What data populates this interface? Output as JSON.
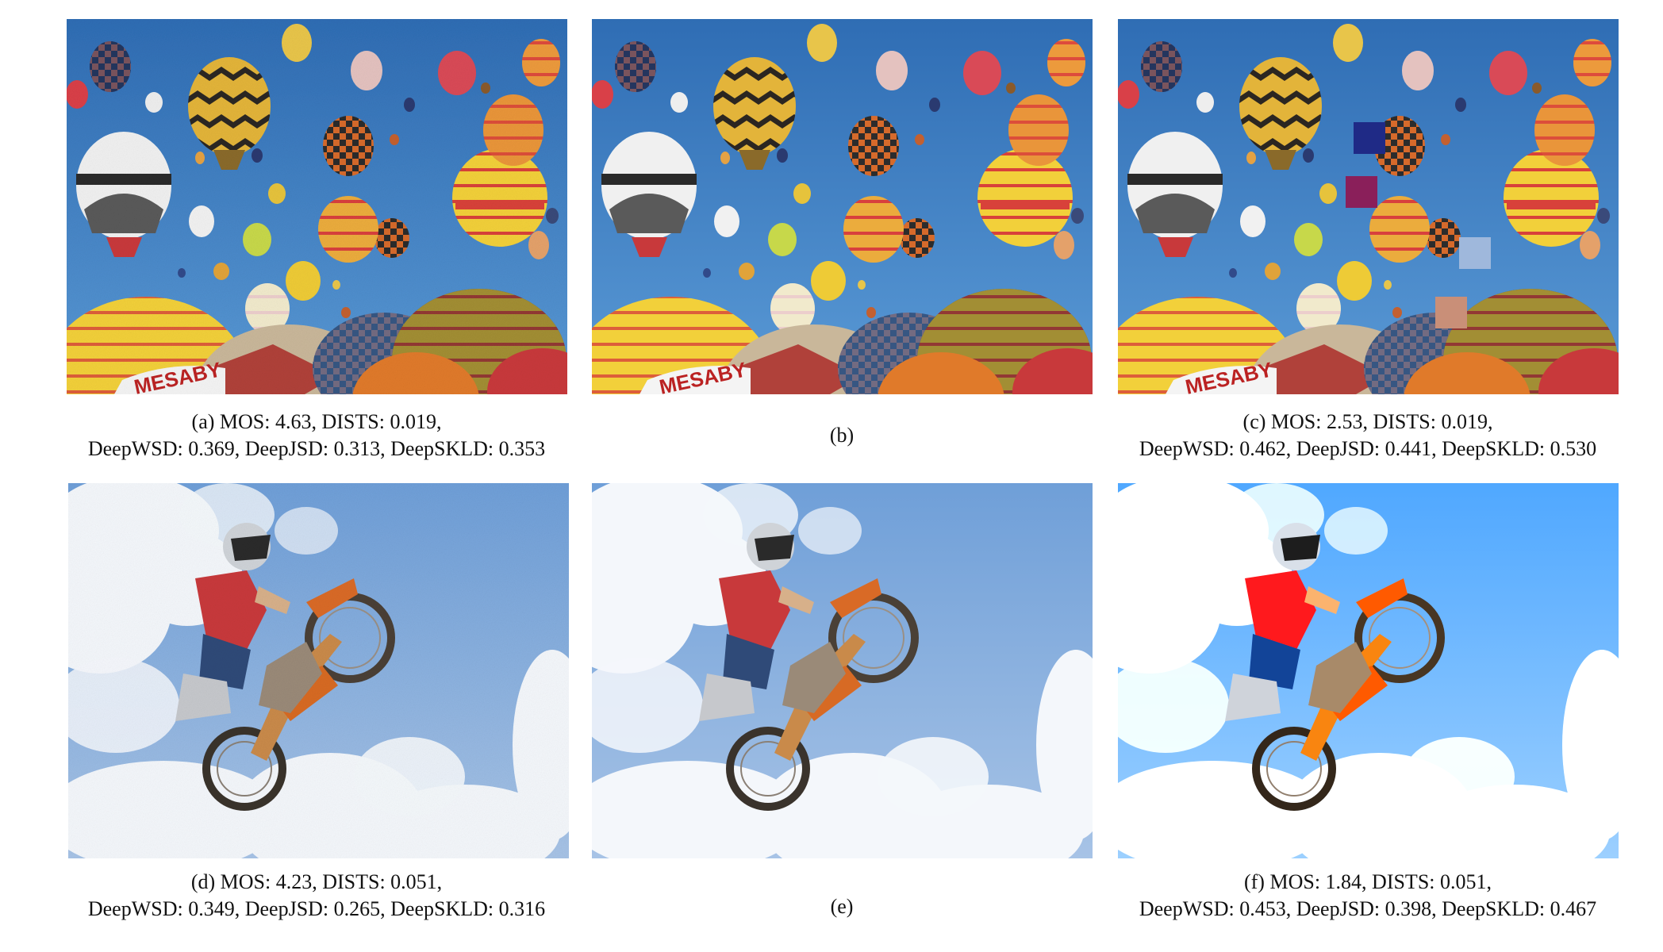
{
  "figure": {
    "panels": [
      {
        "id": "a",
        "scene": "hot-air-balloons",
        "variant": "distorted-noise"
      },
      {
        "id": "b",
        "scene": "hot-air-balloons",
        "variant": "reference"
      },
      {
        "id": "c",
        "scene": "hot-air-balloons",
        "variant": "color-patches"
      },
      {
        "id": "d",
        "scene": "motocross-jump",
        "variant": "distorted-noise"
      },
      {
        "id": "e",
        "scene": "motocross-jump",
        "variant": "reference"
      },
      {
        "id": "f",
        "scene": "motocross-jump",
        "variant": "color-patches"
      }
    ],
    "captions": {
      "a": {
        "line1": "(a)  MOS: 4.63, DISTS: 0.019,",
        "line2": "DeepWSD: 0.369, DeepJSD: 0.313, DeepSKLD:  0.353"
      },
      "b": {
        "line1": "(b)"
      },
      "c": {
        "line1": "(c)  MOS: 2.53, DISTS: 0.019,",
        "line2": "DeepWSD: 0.462, DeepJSD: 0.441, DeepSKLD:  0.530"
      },
      "d": {
        "line1": "(d)  MOS: 4.23, DISTS: 0.051,",
        "line2": "DeepWSD: 0.349, DeepJSD: 0.265, DeepSKLD:  0.316"
      },
      "e": {
        "line1": "(e)"
      },
      "f": {
        "line1": "(f)  MOS: 1.84, DISTS: 0.051,",
        "line2": "DeepWSD: 0.453, DeepJSD: 0.398, DeepSKLD:  0.467"
      }
    },
    "patch_colors": [
      "#1f2a86",
      "#8a1f5a",
      "#9fb8dc",
      "#c98f78"
    ],
    "colors": {
      "sky_blue": "#3f7fc4",
      "cloud_sky": "#7aa5d9"
    }
  }
}
